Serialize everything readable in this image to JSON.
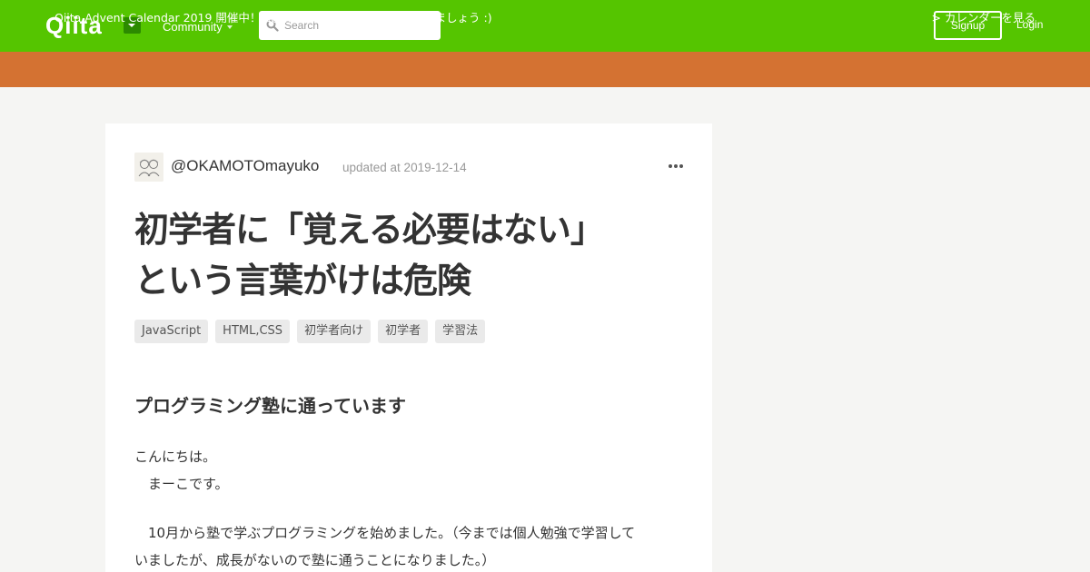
{
  "header": {
    "logo_text": "Qiita",
    "community_label": "Community",
    "search_placeholder": "Search",
    "signup_label": "Signup",
    "login_label": "Login",
    "brand_color": "#55c500"
  },
  "announcement": {
    "text": "Qiita Advent Calendar 2019 開催中！ 最高に盛り上がる年末にしていきましょう :)",
    "link_label": "> カレンダーを見る",
    "color": "#d47232"
  },
  "article": {
    "author": "@OKAMOTOmayuko",
    "updated": "updated at 2019-12-14",
    "title_line1": "初学者に「覚える必要はない」",
    "title_line2": "という言葉がけは危険",
    "tags": [
      "JavaScript",
      "HTML,CSS",
      "初学者向け",
      "初学者",
      "学習法"
    ],
    "heading": "プログラミング塾に通っています",
    "para1_line1": "こんにちは。",
    "para1_line2": "　まーこです。",
    "para2_line1": "　10月から塾で学ぶプログラミングを始めました。（今までは個人勉強で学習して",
    "para2_line2": "いましたが、成長がないので塾に通うことになりました。）"
  }
}
